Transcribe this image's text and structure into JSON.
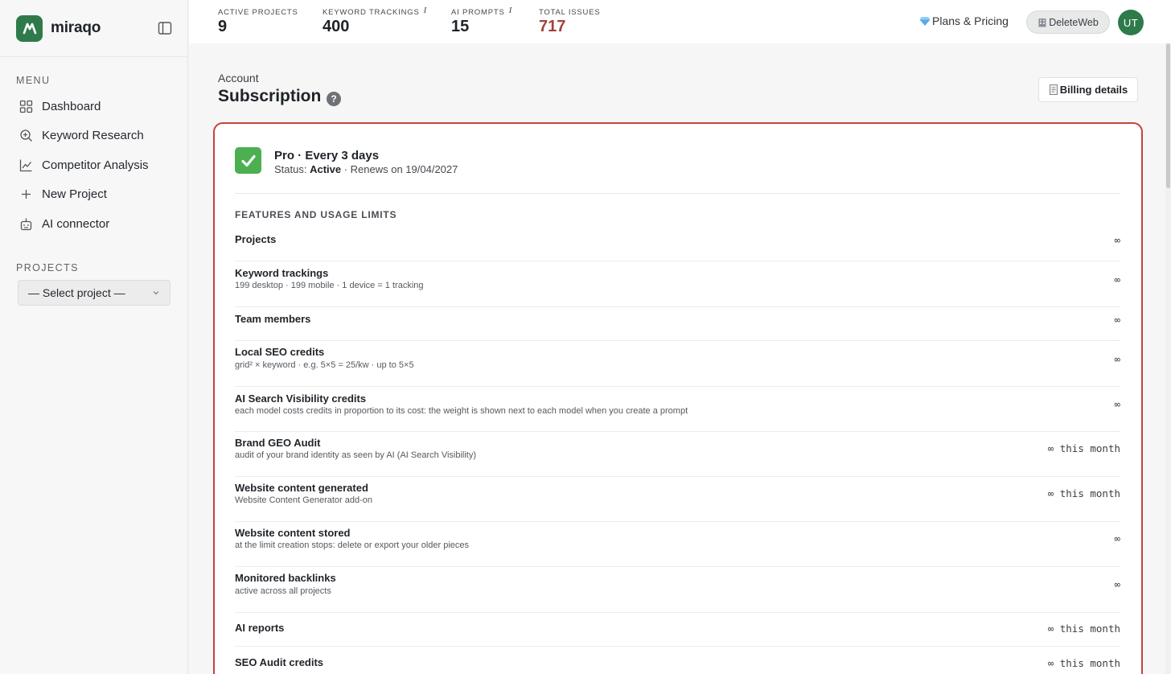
{
  "brand": {
    "name": "miraqo"
  },
  "menu": {
    "label": "MENU",
    "items": [
      {
        "label": "Dashboard",
        "icon": "grid-icon"
      },
      {
        "label": "Keyword Research",
        "icon": "search-icon"
      },
      {
        "label": "Competitor Analysis",
        "icon": "line-chart-icon"
      },
      {
        "label": "New Project",
        "icon": "plus-icon"
      },
      {
        "label": "AI connector",
        "icon": "robot-icon"
      }
    ]
  },
  "projects": {
    "label": "PROJECTS",
    "select_value": "— Select project —"
  },
  "stats": [
    {
      "label": "ACTIVE PROJECTS",
      "value": "9",
      "info": ""
    },
    {
      "label": "KEYWORD TRACKINGS",
      "value": "400",
      "info": "i"
    },
    {
      "label": "AI PROMPTS",
      "value": "15",
      "info": "i"
    },
    {
      "label": "TOTAL ISSUES",
      "value": "717",
      "info": "",
      "color": "#a3423a"
    }
  ],
  "topbar": {
    "plans_label": "Plans & Pricing",
    "site_label": "DeleteWeb",
    "avatar_initials": "UT"
  },
  "header": {
    "breadcrumb": "Account",
    "title": "Subscription",
    "help": "?",
    "billing_label": "Billing details"
  },
  "plan": {
    "name": "Pro · Every 3 days",
    "status_prefix": "Status: ",
    "status": "Active",
    "renewal": " · Renews on 19/04/2027"
  },
  "features": {
    "title": "FEATURES AND USAGE LIMITS",
    "items": [
      {
        "name": "Projects",
        "sub": "",
        "value": "∞"
      },
      {
        "name": "Keyword trackings",
        "sub": "199 desktop · 199 mobile · 1 device = 1 tracking",
        "value": "∞"
      },
      {
        "name": "Team members",
        "sub": "",
        "value": "∞"
      },
      {
        "name": "Local SEO credits",
        "sub": "grid² × keyword · e.g. 5×5 = 25/kw · up to 5×5",
        "value": "∞"
      },
      {
        "name": "AI Search Visibility credits",
        "sub": "each model costs credits in proportion to its cost: the weight is shown next to each model when you create a prompt",
        "value": "∞"
      },
      {
        "name": "Brand GEO Audit",
        "sub": "audit of your brand identity as seen by AI (AI Search Visibility)",
        "value": "∞ this month"
      },
      {
        "name": "Website content generated",
        "sub": "Website Content Generator add-on",
        "value": "∞ this month"
      },
      {
        "name": "Website content stored",
        "sub": "at the limit creation stops: delete or export your older pieces",
        "value": "∞"
      },
      {
        "name": "Monitored backlinks",
        "sub": "active across all projects",
        "value": "∞"
      },
      {
        "name": "AI reports",
        "sub": "",
        "value": "∞ this month"
      },
      {
        "name": "SEO Audit credits",
        "sub": "",
        "value": "∞ this month"
      }
    ]
  },
  "colors": {
    "brand": "#2f7a4b",
    "highlight_border": "#c9413c",
    "issues": "#a3423a"
  }
}
